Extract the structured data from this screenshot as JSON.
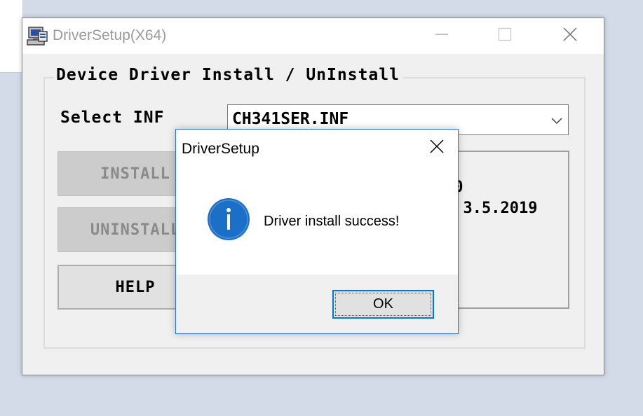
{
  "main_window": {
    "title": "DriverSetup(X64)",
    "group_label": "Device Driver Install / UnInstall",
    "select_label": "Select INF",
    "inf_value": "CH341SER.INF",
    "buttons": {
      "install": "INSTALL",
      "uninstall": "UNINSTALL",
      "help": "HELP"
    },
    "info_lines": [
      "40",
      ", 3.5.2019"
    ]
  },
  "dialog": {
    "title": "DriverSetup",
    "message": "Driver install success!",
    "ok_label": "OK"
  },
  "colors": {
    "accent": "#0078d7",
    "info_icon": "#1c6fc6"
  },
  "icons": [
    "app-setup-icon",
    "minimize-icon",
    "maximize-icon",
    "close-icon",
    "chevron-down-icon",
    "info-icon"
  ]
}
